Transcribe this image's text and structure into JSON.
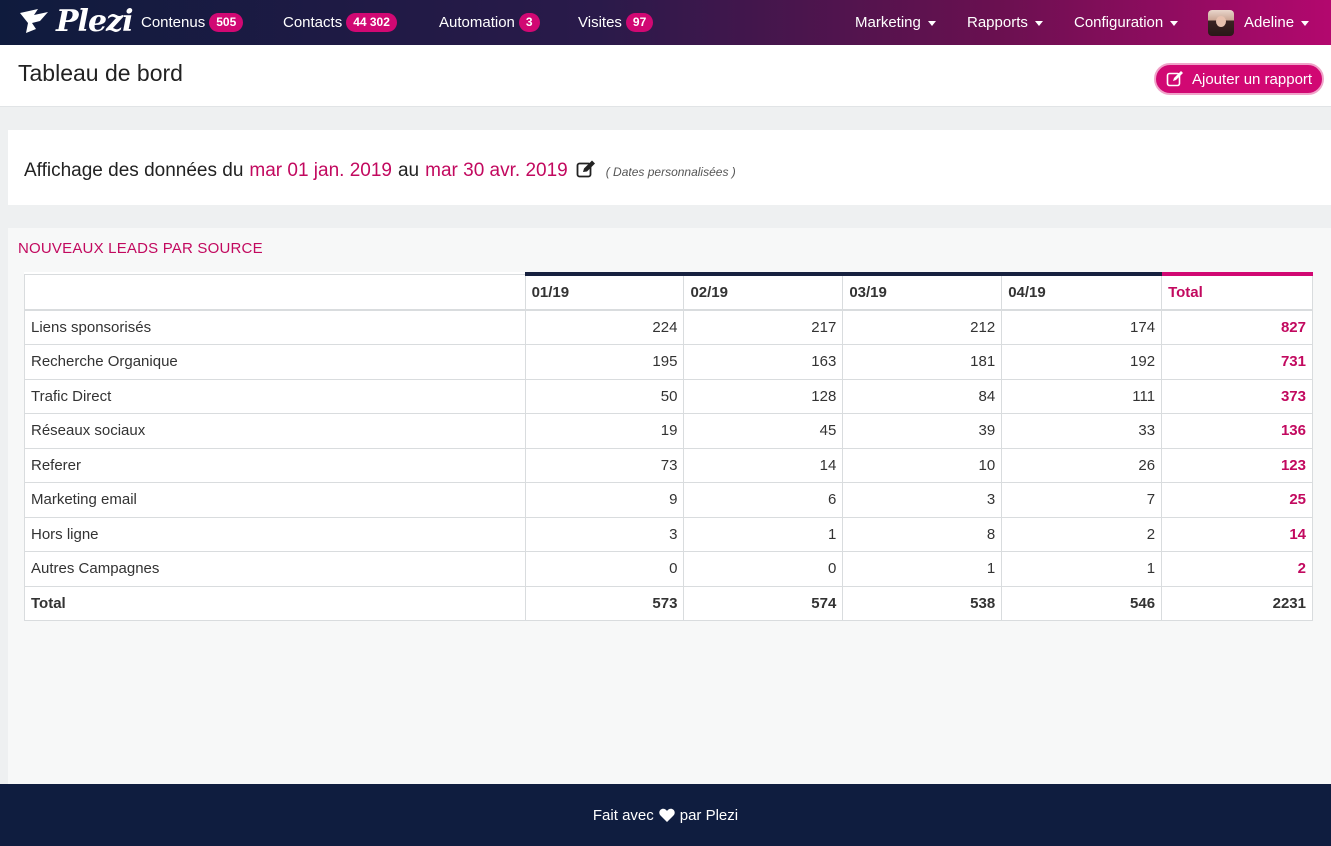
{
  "nav": {
    "brand": "Plezi",
    "items": [
      {
        "label": "Contenus",
        "badge": "505"
      },
      {
        "label": "Contacts",
        "badge": "44 302"
      },
      {
        "label": "Automation",
        "badge": "3"
      },
      {
        "label": "Visites",
        "badge": "97"
      }
    ],
    "menus": [
      {
        "label": "Marketing"
      },
      {
        "label": "Rapports"
      },
      {
        "label": "Configuration"
      }
    ],
    "user": {
      "name": "Adeline"
    }
  },
  "header": {
    "title": "Tableau de bord",
    "add_report_label": "Ajouter un rapport"
  },
  "date_range": {
    "prefix": "Affichage des données du",
    "start": "mar 01 jan. 2019",
    "middle": "au",
    "end": "mar 30 avr. 2019",
    "note": "( Dates personnalisées )"
  },
  "report": {
    "title": "NOUVEAUX LEADS PAR SOURCE",
    "columns": [
      "01/19",
      "02/19",
      "03/19",
      "04/19",
      "Total"
    ],
    "rows": [
      {
        "label": "Liens sponsorisés",
        "values": [
          "224",
          "217",
          "212",
          "174"
        ],
        "total": "827"
      },
      {
        "label": "Recherche Organique",
        "values": [
          "195",
          "163",
          "181",
          "192"
        ],
        "total": "731"
      },
      {
        "label": "Trafic Direct",
        "values": [
          "50",
          "128",
          "84",
          "111"
        ],
        "total": "373"
      },
      {
        "label": "Réseaux sociaux",
        "values": [
          "19",
          "45",
          "39",
          "33"
        ],
        "total": "136"
      },
      {
        "label": "Referer",
        "values": [
          "73",
          "14",
          "10",
          "26"
        ],
        "total": "123"
      },
      {
        "label": "Marketing email",
        "values": [
          "9",
          "6",
          "3",
          "7"
        ],
        "total": "25"
      },
      {
        "label": "Hors ligne",
        "values": [
          "3",
          "1",
          "8",
          "2"
        ],
        "total": "14"
      },
      {
        "label": "Autres Campagnes",
        "values": [
          "0",
          "0",
          "1",
          "1"
        ],
        "total": "2"
      }
    ],
    "total_row": {
      "label": "Total",
      "values": [
        "573",
        "574",
        "538",
        "546"
      ],
      "total": "2231"
    }
  },
  "footer": {
    "before": "Fait avec",
    "after": "par Plezi"
  },
  "colors": {
    "accent": "#d10873",
    "nav_dark": "#0f1b3d",
    "footer": "#0f1d3f"
  },
  "icons": {
    "logo": "plezi-bird-logo",
    "edit": "edit-icon",
    "heart": "heart-icon",
    "add": "edit-icon"
  }
}
